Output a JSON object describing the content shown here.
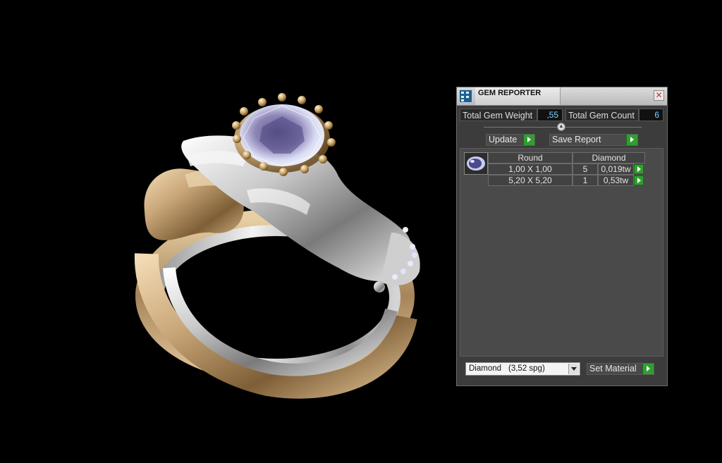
{
  "panel": {
    "title": "GEM REPORTER",
    "total_weight_label": "Total Gem Weight",
    "total_weight_value": ",55",
    "total_count_label": "Total Gem Count",
    "total_count_value": "6",
    "update_label": "Update",
    "save_report_label": "Save Report",
    "table": {
      "header_shape": "Round",
      "header_material": "Diamond",
      "rows": [
        {
          "size": "1,00 X 1,00",
          "count": "5",
          "weight": "0,019tw"
        },
        {
          "size": "5,20 X 5,20",
          "count": "1",
          "weight": "0,53tw"
        }
      ]
    },
    "material_select": {
      "value": "Diamond",
      "spg": "(3,52 spg)"
    },
    "set_material_label": "Set Material"
  },
  "icons": {
    "app": "gem-reporter-icon",
    "close": "close-icon",
    "go": "play-arrow-icon",
    "collapse": "chevron-up-icon",
    "dropdown": "chevron-down-icon",
    "gem": "round-diamond-icon"
  },
  "colors": {
    "panel_bg": "#3c3c3c",
    "value_text": "#7fd0ff",
    "go_button": "#2fa02f",
    "gold": "#c8a87c",
    "silver": "#d8d8d8"
  }
}
